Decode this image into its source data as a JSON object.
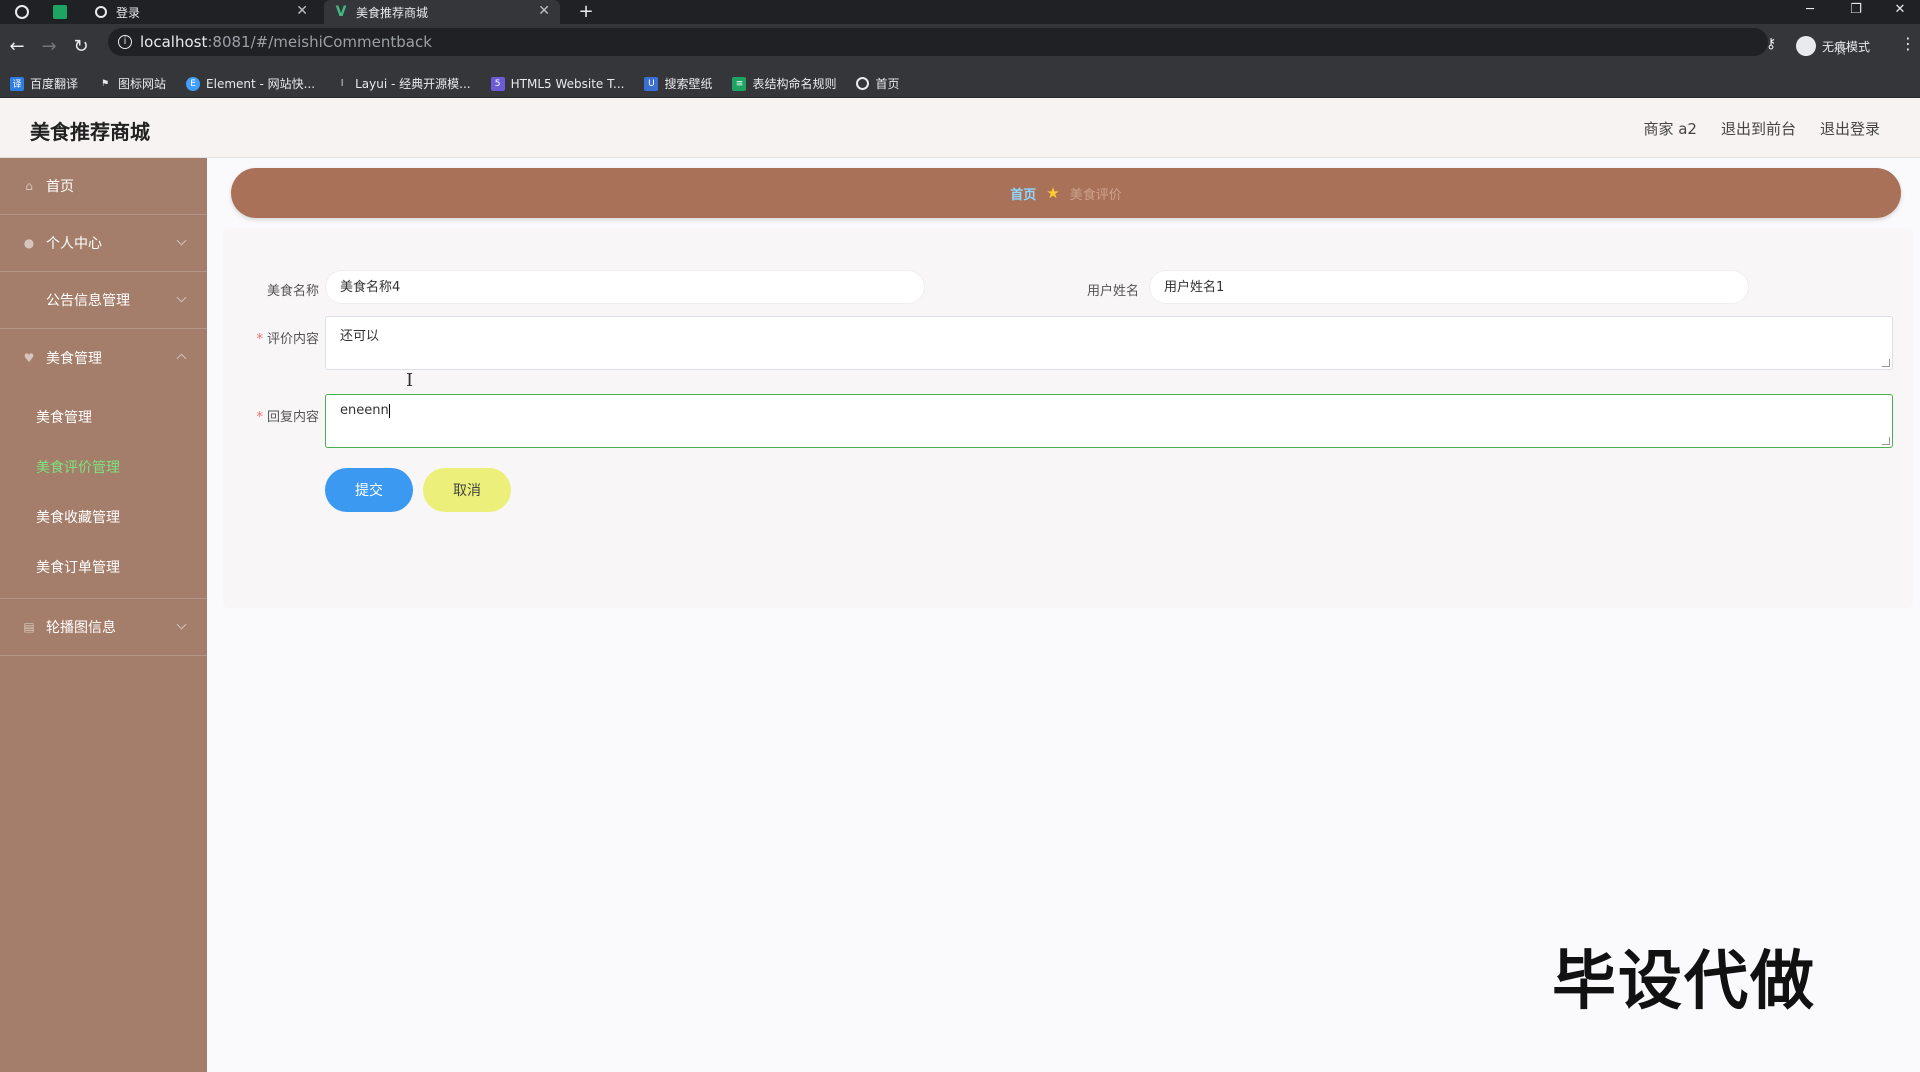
{
  "browser": {
    "tabs": [
      {
        "label": "登录",
        "icon": "globe-icon"
      },
      {
        "label": "美食推荐商城",
        "icon": "vue-icon"
      }
    ],
    "new_tab": "+",
    "url_host": "localhost",
    "url_path": ":8081/#/meishiCommentback",
    "incognito_label": "无痕模式",
    "bookmarks": [
      {
        "label": "百度翻译",
        "icon": "translate-icon",
        "color": "#2f7de1"
      },
      {
        "label": "图标网站",
        "icon": "flag-icon",
        "color": "#444444"
      },
      {
        "label": "Element - 网站快...",
        "icon": "element-icon",
        "color": "#409eff"
      },
      {
        "label": "Layui - 经典开源模...",
        "icon": "layui-icon",
        "color": "#666666"
      },
      {
        "label": "HTML5 Website T...",
        "icon": "html5-icon",
        "color": "#6b5bd6"
      },
      {
        "label": "搜索壁纸",
        "icon": "wallpaper-icon",
        "color": "#3a6fd6"
      },
      {
        "label": "表结构命名规则",
        "icon": "sheet-icon",
        "color": "#1da462"
      },
      {
        "label": "首页",
        "icon": "globe-icon",
        "color": "#555555"
      }
    ]
  },
  "header": {
    "brand": "美食推荐商城",
    "user": "商家 a2",
    "to_front": "退出到前台",
    "logout": "退出登录"
  },
  "sidebar": {
    "items": [
      {
        "label": "首页",
        "icon": "home-icon"
      },
      {
        "label": "个人中心",
        "icon": "user-icon"
      },
      {
        "label": "公告信息管理",
        "icon": "notice-icon"
      },
      {
        "label": "美食管理",
        "icon": "food-icon"
      }
    ],
    "submenu": [
      {
        "label": "美食管理"
      },
      {
        "label": "美食评价管理"
      },
      {
        "label": "美食收藏管理"
      },
      {
        "label": "美食订单管理"
      }
    ],
    "last_item": {
      "label": "轮播图信息",
      "icon": "carousel-icon"
    }
  },
  "breadcrumb": {
    "home": "首页",
    "current": "美食评价"
  },
  "form": {
    "food_name_label": "美食名称",
    "food_name_value": "美食名称4",
    "user_name_label": "用户姓名",
    "user_name_value": "用户姓名1",
    "comment_label": "评价内容",
    "comment_value": "还可以",
    "reply_label": "回复内容",
    "reply_value": "eneenn",
    "submit_label": "提交",
    "cancel_label": "取消"
  },
  "watermark": "毕设代做",
  "colors": {
    "sidebar": "#a47e6b",
    "breadcrumb": "#a97157",
    "submit": "#3b99f2",
    "cancel": "#ecf07a",
    "active_menu": "#7ee27e"
  }
}
